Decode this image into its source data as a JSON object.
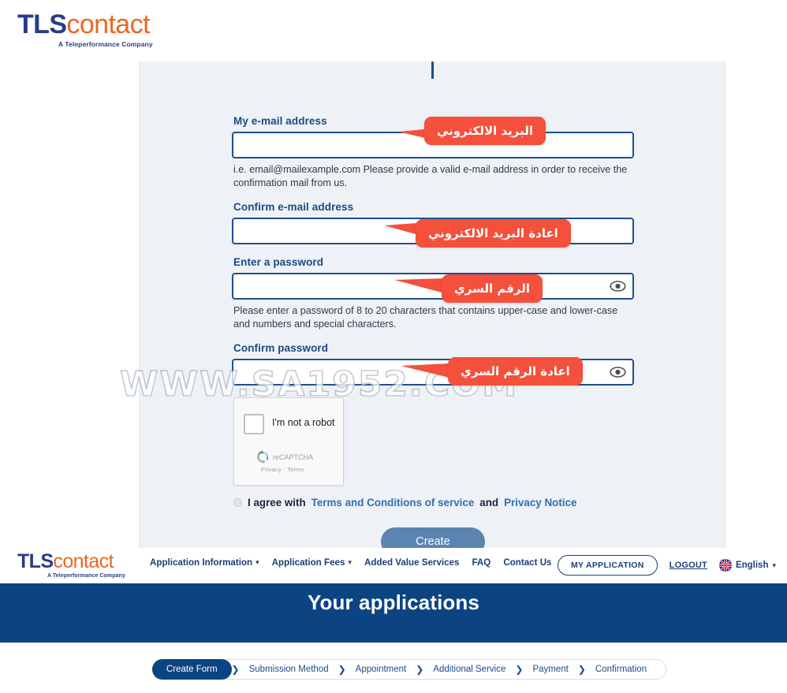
{
  "brand": {
    "logo_primary": "TLS",
    "logo_secondary": "contact",
    "tagline": "A Teleperformance Company"
  },
  "form": {
    "email": {
      "label": "My e-mail address",
      "value": "",
      "hint": "i.e. email@mailexample.com Please provide a valid e-mail address in order to receive the confirmation mail from us.",
      "callout": "البريد الالكتروني"
    },
    "confirm_email": {
      "label": "Confirm e-mail address",
      "value": "",
      "callout": "اعادة البريد الالكتروني"
    },
    "password": {
      "label": "Enter a password",
      "value": "",
      "hint": "Please enter a password of 8 to 20 characters that contains upper-case and lower-case and numbers and special characters.",
      "callout": "الرقم السري",
      "toggle_icon": "eye-icon"
    },
    "confirm_password": {
      "label": "Confirm password",
      "value": "",
      "callout": "اعادة الرقم السري",
      "toggle_icon": "eye-icon"
    },
    "recaptcha": {
      "label": "I'm not a robot",
      "brand": "reCAPTCHA",
      "legal": "Privacy - Terms"
    },
    "agree": {
      "prefix": "I agree with",
      "terms_link": "Terms and Conditions of service",
      "conjunction": "and",
      "privacy_link": "Privacy Notice"
    },
    "submit_label": "Create"
  },
  "watermark": "WWW.SA1952.COM",
  "nav": {
    "items": [
      {
        "label": "Application Information",
        "has_chevron": true
      },
      {
        "label": "Application Fees",
        "has_chevron": true
      },
      {
        "label": "Added Value Services",
        "has_chevron": false
      },
      {
        "label": "FAQ",
        "has_chevron": false
      },
      {
        "label": "Contact Us",
        "has_chevron": false
      }
    ],
    "my_application": "MY APPLICATION",
    "logout": "LOGOUT",
    "language": "English"
  },
  "banner": {
    "title": "Your applications"
  },
  "steps": [
    {
      "label": "Create Form",
      "active": true
    },
    {
      "label": "Submission Method",
      "active": false
    },
    {
      "label": "Appointment",
      "active": false
    },
    {
      "label": "Additional Service",
      "active": false
    },
    {
      "label": "Payment",
      "active": false
    },
    {
      "label": "Confirmation",
      "active": false
    }
  ],
  "colors": {
    "brand_blue": "#2a3c87",
    "brand_orange": "#ea6724",
    "banner_blue": "#0c4483",
    "callout_red": "#f4503c",
    "input_border": "#1f5090",
    "button_blue": "#5c84b0"
  }
}
